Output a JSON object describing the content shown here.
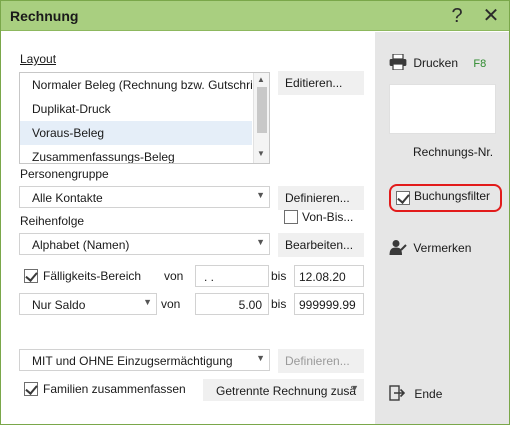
{
  "window": {
    "title": "Rechnung",
    "help_glyph": "?",
    "close_glyph": "✕"
  },
  "layout": {
    "label": "Layout",
    "items": [
      {
        "label": "Normaler Beleg (Rechnung bzw. Gutschrift)"
      },
      {
        "label": "Duplikat-Druck"
      },
      {
        "label": "Voraus-Beleg"
      },
      {
        "label": "Zusammenfassungs-Beleg"
      }
    ],
    "selected_index": 2,
    "edit_button": "Editieren..."
  },
  "personengruppe": {
    "label": "Personengruppe",
    "value": "Alle Kontakte",
    "define_button": "Definieren...",
    "von_bis_label": "Von-Bis..."
  },
  "reihenfolge": {
    "label": "Reihenfolge",
    "value": "Alphabet (Namen)",
    "edit_button": "Bearbeiten..."
  },
  "faelligkeit": {
    "label": "Fälligkeits-Bereich",
    "checked": true,
    "von_label": "von",
    "von_value": ". .",
    "bis_label": "bis",
    "bis_value": "12.08.20"
  },
  "saldo": {
    "value": "Nur Saldo",
    "von_label": "von",
    "von_value": "5.00",
    "bis_label": "bis",
    "bis_value": "999999.99"
  },
  "einzug": {
    "value": "MIT und OHNE Einzugsermächtigung",
    "define_button": "Definieren..."
  },
  "familien": {
    "label": "Familien zusammenfassen",
    "checked": true,
    "value": "Getrennte Rechnung zusä"
  },
  "sidebar": {
    "print_label": "Drucken",
    "print_shortcut": "F8",
    "nr_label": "Rechnungs-Nr.",
    "buchungsfilter_label": "Buchungsfilter",
    "buchungsfilter_checked": true,
    "vermerken_label": "Vermerken",
    "end_label": "Ende"
  },
  "colors": {
    "titlebar": "#a9cf80",
    "highlight": "#e21b1b",
    "selection": "#e5eef8",
    "shortcut": "#2e8b2e"
  }
}
